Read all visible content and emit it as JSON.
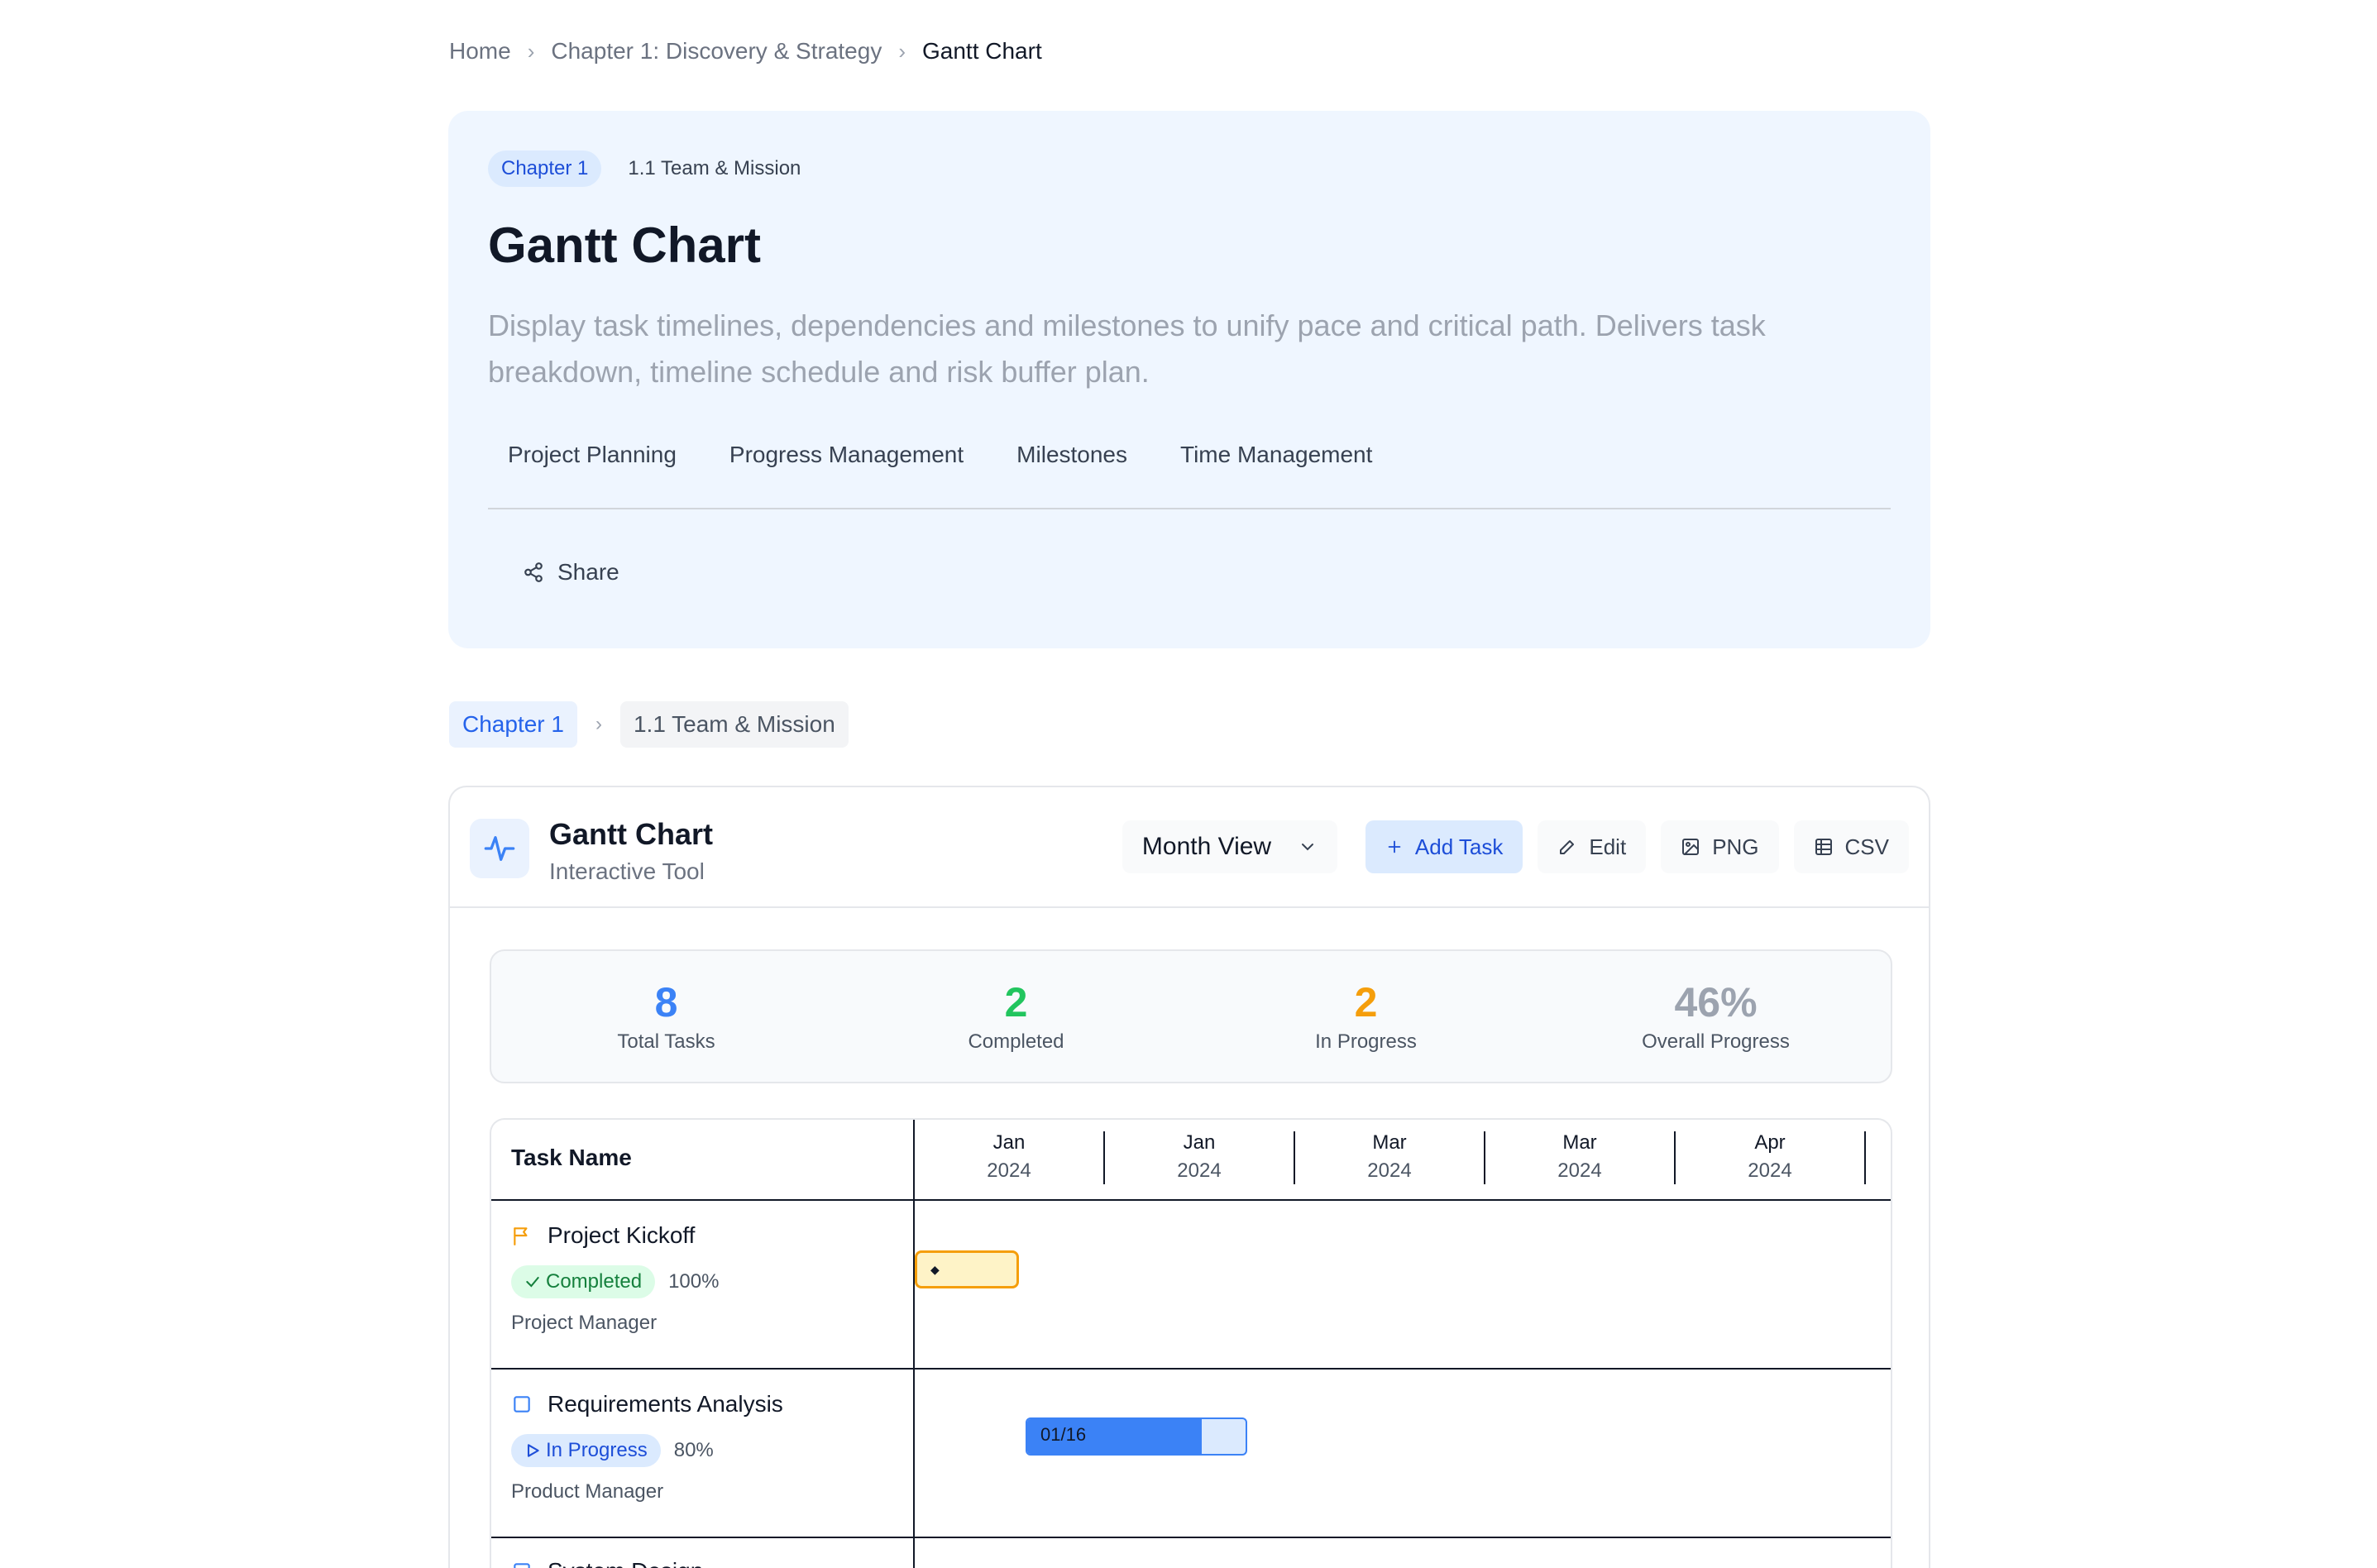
{
  "breadcrumb": {
    "items": [
      "Home",
      "Chapter 1: Discovery & Strategy"
    ],
    "current": "Gantt Chart"
  },
  "hero": {
    "chapter_badge": "Chapter 1",
    "section": "1.1 Team & Mission",
    "title": "Gantt Chart",
    "description": "Display task timelines, dependencies and milestones to unify pace and critical path. Delivers task breakdown, timeline schedule and risk buffer plan.",
    "tags": [
      "Project Planning",
      "Progress Management",
      "Milestones",
      "Time Management"
    ],
    "share_label": "Share"
  },
  "sub_breadcrumb": {
    "chapter": "Chapter 1",
    "section": "1.1 Team & Mission"
  },
  "tool": {
    "title": "Gantt Chart",
    "subtitle": "Interactive Tool",
    "view_select": "Month View",
    "add_task_label": "Add Task",
    "edit_label": "Edit",
    "png_label": "PNG",
    "csv_label": "CSV"
  },
  "stats": {
    "total": {
      "value": "8",
      "label": "Total Tasks",
      "color": "#3b82f6"
    },
    "completed": {
      "value": "2",
      "label": "Completed",
      "color": "#22c55e"
    },
    "in_progress": {
      "value": "2",
      "label": "In Progress",
      "color": "#f59e0b"
    },
    "overall": {
      "value": "46%",
      "label": "Overall Progress",
      "color": "#9ca3af"
    }
  },
  "gantt": {
    "task_name_header": "Task Name",
    "months": [
      {
        "month": "Jan",
        "year": "2024"
      },
      {
        "month": "Jan",
        "year": "2024"
      },
      {
        "month": "Mar",
        "year": "2024"
      },
      {
        "month": "Mar",
        "year": "2024"
      },
      {
        "month": "Apr",
        "year": "2024"
      }
    ],
    "tasks": [
      {
        "name": "Project Kickoff",
        "status": "Completed",
        "progress_label": "100%",
        "progress": 1.0,
        "owner": "Project Manager",
        "type": "milestone",
        "bar_label": "◆"
      },
      {
        "name": "Requirements Analysis",
        "status": "In Progress",
        "progress_label": "80%",
        "progress": 0.8,
        "owner": "Product Manager",
        "type": "task",
        "bar_label": "01/16"
      },
      {
        "name": "System Design",
        "status": "",
        "progress_label": "",
        "owner": "",
        "type": "task"
      }
    ]
  },
  "colors": {
    "accent": "#3b82f6",
    "milestone": "#f59e0b",
    "success": "#22c55e"
  }
}
